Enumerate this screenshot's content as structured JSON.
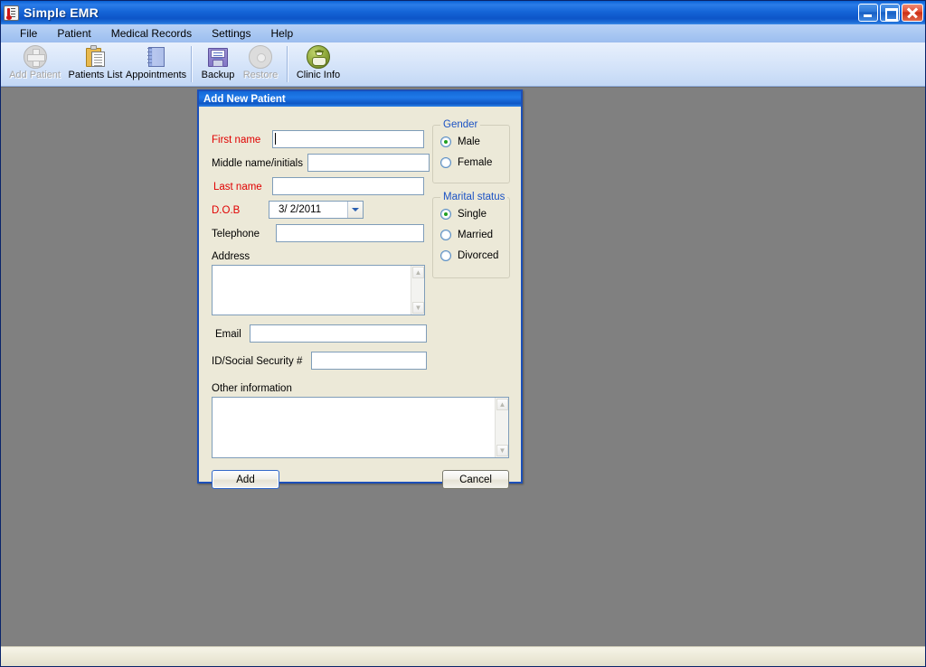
{
  "window": {
    "title": "Simple EMR",
    "icon": "thermometer-icon",
    "controls": {
      "minimize": "Minimize",
      "restore": "Restore",
      "close": "Close"
    }
  },
  "menu": {
    "items": [
      {
        "label": "File"
      },
      {
        "label": "Patient"
      },
      {
        "label": "Medical Records"
      },
      {
        "label": "Settings"
      },
      {
        "label": "Help"
      }
    ]
  },
  "toolbar": {
    "buttons": [
      {
        "label": "Add Patient",
        "icon": "add-patient-icon",
        "enabled": false
      },
      {
        "label": "Patients List",
        "icon": "clipboard-icon",
        "enabled": true
      },
      {
        "label": "Appointments",
        "icon": "notebook-icon",
        "enabled": true
      },
      {
        "label": "Backup",
        "icon": "floppy-disk-icon",
        "enabled": true
      },
      {
        "label": "Restore",
        "icon": "restore-disc-icon",
        "enabled": false
      },
      {
        "label": "Clinic Info",
        "icon": "clinic-icon",
        "enabled": true
      }
    ]
  },
  "status_bar": {
    "text": ""
  },
  "dialog": {
    "title": "Add New Patient",
    "fields": {
      "first_name": {
        "label": "First name",
        "value": "",
        "required": true,
        "focused": true
      },
      "middle_name": {
        "label": "Middle name/initials",
        "value": "",
        "required": false,
        "focused": false
      },
      "last_name": {
        "label": "Last name",
        "value": "",
        "required": true,
        "focused": false
      },
      "dob": {
        "label": "D.O.B",
        "value": "3/ 2/2011",
        "required": true
      },
      "telephone": {
        "label": "Telephone",
        "value": "",
        "required": false
      },
      "address": {
        "label": "Address",
        "value": ""
      },
      "email": {
        "label": "Email",
        "value": ""
      },
      "ssn": {
        "label": "ID/Social Security #",
        "value": ""
      },
      "other_info": {
        "label": "Other information",
        "value": ""
      }
    },
    "gender": {
      "title": "Gender",
      "options": [
        {
          "label": "Male",
          "selected": true
        },
        {
          "label": "Female",
          "selected": false
        }
      ]
    },
    "marital_status": {
      "title": "Marital status",
      "options": [
        {
          "label": "Single",
          "selected": true
        },
        {
          "label": "Married",
          "selected": false
        },
        {
          "label": "Divorced",
          "selected": false
        }
      ]
    },
    "buttons": {
      "add": "Add",
      "cancel": "Cancel"
    }
  },
  "colors": {
    "title_bar_blue": "#1565d8",
    "desktop_grey": "#808080",
    "form_beige": "#ece9d8",
    "required_red": "#e00000",
    "group_label_blue": "#1b52c4",
    "radio_dot_green": "#21a021"
  }
}
